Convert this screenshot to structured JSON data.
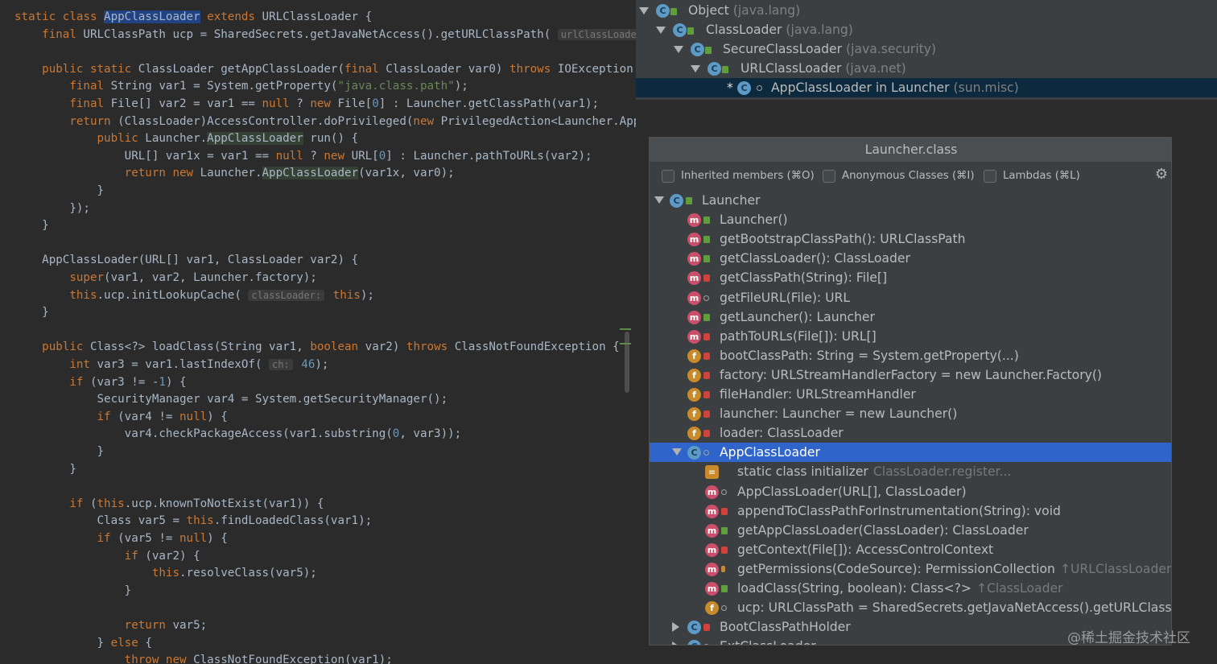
{
  "editor": {
    "lines": [
      [
        [
          "static class ",
          "kw"
        ],
        [
          "AppClassLoader",
          "sel"
        ],
        [
          " extends ",
          "kw"
        ],
        [
          "URLClassLoader {",
          ""
        ]
      ],
      [
        [
          "    final ",
          "kw"
        ],
        [
          "URLClassPath ucp = SharedSecrets.getJavaNetAccess().getURLClassPath( ",
          ""
        ],
        [
          "urlClassLoader:",
          "hint"
        ]
      ],
      [],
      [
        [
          "    public static ",
          "kw"
        ],
        [
          "ClassLoader getAppClassLoader(",
          ""
        ],
        [
          "final ",
          "kw"
        ],
        [
          "ClassLoader var0) ",
          ""
        ],
        [
          "throws ",
          "kw"
        ],
        [
          "IOException ·",
          ""
        ]
      ],
      [
        [
          "        final ",
          "kw"
        ],
        [
          "String var1 = System.getProperty(",
          ""
        ],
        [
          "\"java.class.path\"",
          "str"
        ],
        [
          ");",
          ""
        ]
      ],
      [
        [
          "        final ",
          "kw"
        ],
        [
          "File[] var2 = var1 == ",
          ""
        ],
        [
          "null",
          "kw"
        ],
        [
          " ? ",
          ""
        ],
        [
          "new ",
          "kw"
        ],
        [
          "File[",
          ""
        ],
        [
          "0",
          "num"
        ],
        [
          "] : Launcher.getClassPath(var1);",
          ""
        ]
      ],
      [
        [
          "        return ",
          "kw"
        ],
        [
          "(ClassLoader)AccessController.doPrivileged(",
          ""
        ],
        [
          "new ",
          "kw"
        ],
        [
          "PrivilegedAction<Launcher.App(",
          ""
        ]
      ],
      [
        [
          "            public ",
          "kw"
        ],
        [
          "Launcher.",
          ""
        ],
        [
          "AppClassLoader",
          "hl"
        ],
        [
          " run() {",
          ""
        ]
      ],
      [
        [
          "                URL[] var1x = var1 == ",
          ""
        ],
        [
          "null",
          "kw"
        ],
        [
          " ? ",
          ""
        ],
        [
          "new ",
          "kw"
        ],
        [
          "URL[",
          ""
        ],
        [
          "0",
          "num"
        ],
        [
          "] : Launcher.pathToURLs(var2);",
          ""
        ]
      ],
      [
        [
          "                return new ",
          "kw"
        ],
        [
          "Launcher.",
          ""
        ],
        [
          "AppClassLoader",
          "hl"
        ],
        [
          "(var1x, var0);",
          ""
        ]
      ],
      [
        [
          "            }",
          ""
        ]
      ],
      [
        [
          "        });",
          ""
        ]
      ],
      [
        [
          "    }",
          ""
        ]
      ],
      [],
      [
        [
          "    AppClassLoader(URL[] var1, ClassLoader var2) {",
          ""
        ]
      ],
      [
        [
          "        super",
          "kw"
        ],
        [
          "(var1, var2, Launcher.factory);",
          ""
        ]
      ],
      [
        [
          "        this",
          "kw"
        ],
        [
          ".ucp.initLookupCache( ",
          ""
        ],
        [
          "classLoader:",
          "hint"
        ],
        [
          " this",
          "kw"
        ],
        [
          ");",
          ""
        ]
      ],
      [
        [
          "    }",
          ""
        ]
      ],
      [],
      [
        [
          "    public ",
          "kw"
        ],
        [
          "Class<?> loadClass(String var1, ",
          ""
        ],
        [
          "boolean ",
          "kw"
        ],
        [
          "var2) ",
          ""
        ],
        [
          "throws ",
          "kw"
        ],
        [
          "ClassNotFoundException {",
          ""
        ]
      ],
      [
        [
          "        int ",
          "kw"
        ],
        [
          "var3 = var1.lastIndexOf( ",
          ""
        ],
        [
          "ch:",
          "hint"
        ],
        [
          " 46",
          "num"
        ],
        [
          ");",
          ""
        ]
      ],
      [
        [
          "        if ",
          "kw"
        ],
        [
          "(var3 != -",
          ""
        ],
        [
          "1",
          "num"
        ],
        [
          ") {",
          ""
        ]
      ],
      [
        [
          "            SecurityManager var4 = System.getSecurityManager();",
          ""
        ]
      ],
      [
        [
          "            if ",
          "kw"
        ],
        [
          "(var4 != ",
          ""
        ],
        [
          "null",
          "kw"
        ],
        [
          ") {",
          ""
        ]
      ],
      [
        [
          "                var4.checkPackageAccess(var1.substring(",
          ""
        ],
        [
          "0",
          "num"
        ],
        [
          ", var3));",
          ""
        ]
      ],
      [
        [
          "            }",
          ""
        ]
      ],
      [
        [
          "        }",
          ""
        ]
      ],
      [],
      [
        [
          "        if ",
          "kw"
        ],
        [
          "(",
          ""
        ],
        [
          "this",
          "kw"
        ],
        [
          ".ucp.knownToNotExist(var1)) {",
          ""
        ]
      ],
      [
        [
          "            Class var5 = ",
          ""
        ],
        [
          "this",
          "kw"
        ],
        [
          ".findLoadedClass(var1);",
          ""
        ]
      ],
      [
        [
          "            if ",
          "kw"
        ],
        [
          "(var5 != ",
          ""
        ],
        [
          "null",
          "kw"
        ],
        [
          ") {",
          ""
        ]
      ],
      [
        [
          "                if ",
          "kw"
        ],
        [
          "(var2) {",
          ""
        ]
      ],
      [
        [
          "                    this",
          "kw"
        ],
        [
          ".resolveClass(var5);",
          ""
        ]
      ],
      [
        [
          "                }",
          ""
        ]
      ],
      [],
      [
        [
          "                return ",
          "kw"
        ],
        [
          "var5;",
          ""
        ]
      ],
      [
        [
          "            } ",
          ""
        ],
        [
          "else ",
          "kw"
        ],
        [
          "{",
          ""
        ]
      ],
      [
        [
          "                throw new ",
          "kw"
        ],
        [
          "ClassNotFoundException(var1);",
          ""
        ]
      ]
    ]
  },
  "hierarchy": {
    "rows": [
      {
        "name": "Object",
        "qual": "(java.lang)"
      },
      {
        "name": "ClassLoader",
        "qual": "(java.lang)"
      },
      {
        "name": "SecureClassLoader",
        "qual": "(java.security)"
      },
      {
        "name": "URLClassLoader",
        "qual": "(java.net)"
      },
      {
        "name": "AppClassLoader in Launcher",
        "qual": "(sun.misc)",
        "marker": "*"
      }
    ]
  },
  "structure": {
    "title": "Launcher.class",
    "options": [
      {
        "label": "Inherited members (⌘O)"
      },
      {
        "label": "Anonymous Classes (⌘I)"
      },
      {
        "label": "Lambdas (⌘L)"
      }
    ],
    "items": [
      {
        "label": "Launcher",
        "suffix": "",
        "icon": "c",
        "vis": "pub"
      },
      {
        "label": "Launcher()",
        "suffix": "",
        "icon": "m",
        "vis": "pub"
      },
      {
        "label": "getBootstrapClassPath(): URLClassPath",
        "suffix": "",
        "icon": "m",
        "vis": "pub"
      },
      {
        "label": "getClassLoader(): ClassLoader",
        "suffix": "",
        "icon": "m",
        "vis": "pub"
      },
      {
        "label": "getClassPath(String): File[]",
        "suffix": "",
        "icon": "m",
        "vis": "priv"
      },
      {
        "label": "getFileURL(File): URL",
        "suffix": "",
        "icon": "m",
        "vis": "pkg"
      },
      {
        "label": "getLauncher(): Launcher",
        "suffix": "",
        "icon": "m",
        "vis": "pub"
      },
      {
        "label": "pathToURLs(File[]): URL[]",
        "suffix": "",
        "icon": "m",
        "vis": "priv"
      },
      {
        "label": "bootClassPath: String = System.getProperty(...)",
        "suffix": "",
        "icon": "f",
        "vis": "priv"
      },
      {
        "label": "factory: URLStreamHandlerFactory = new Launcher.Factory()",
        "suffix": "",
        "icon": "f",
        "vis": "priv"
      },
      {
        "label": "fileHandler: URLStreamHandler",
        "suffix": "",
        "icon": "f",
        "vis": "priv"
      },
      {
        "label": "launcher: Launcher = new Launcher()",
        "suffix": "",
        "icon": "f",
        "vis": "priv"
      },
      {
        "label": "loader: ClassLoader",
        "suffix": "",
        "icon": "f",
        "vis": "priv"
      },
      {
        "label": "AppClassLoader",
        "suffix": "",
        "icon": "c",
        "vis": "pkg"
      },
      {
        "label": "static class initializer",
        "suffix": "ClassLoader.register...",
        "icon": "s",
        "vis": ""
      },
      {
        "label": "AppClassLoader(URL[], ClassLoader)",
        "suffix": "",
        "icon": "m",
        "vis": "pkg"
      },
      {
        "label": "appendToClassPathForInstrumentation(String): void",
        "suffix": "",
        "icon": "m",
        "vis": "priv"
      },
      {
        "label": "getAppClassLoader(ClassLoader): ClassLoader",
        "suffix": "",
        "icon": "m",
        "vis": "pub"
      },
      {
        "label": "getContext(File[]): AccessControlContext",
        "suffix": "",
        "icon": "m",
        "vis": "priv"
      },
      {
        "label": "getPermissions(CodeSource): PermissionCollection",
        "suffix": "↑URLClassLoader",
        "icon": "m",
        "vis": "prot"
      },
      {
        "label": "loadClass(String, boolean): Class<?>",
        "suffix": "↑ClassLoader",
        "icon": "m",
        "vis": "pub"
      },
      {
        "label": "ucp: URLClassPath = SharedSecrets.getJavaNetAccess().getURLClass",
        "suffix": "",
        "icon": "f",
        "vis": "pkg"
      },
      {
        "label": "BootClassPathHolder",
        "suffix": "",
        "icon": "c",
        "vis": "priv"
      },
      {
        "label": "ExtClassLoader",
        "suffix": "",
        "icon": "c",
        "vis": "pkg"
      }
    ]
  },
  "watermark": "@稀土掘金技术社区"
}
